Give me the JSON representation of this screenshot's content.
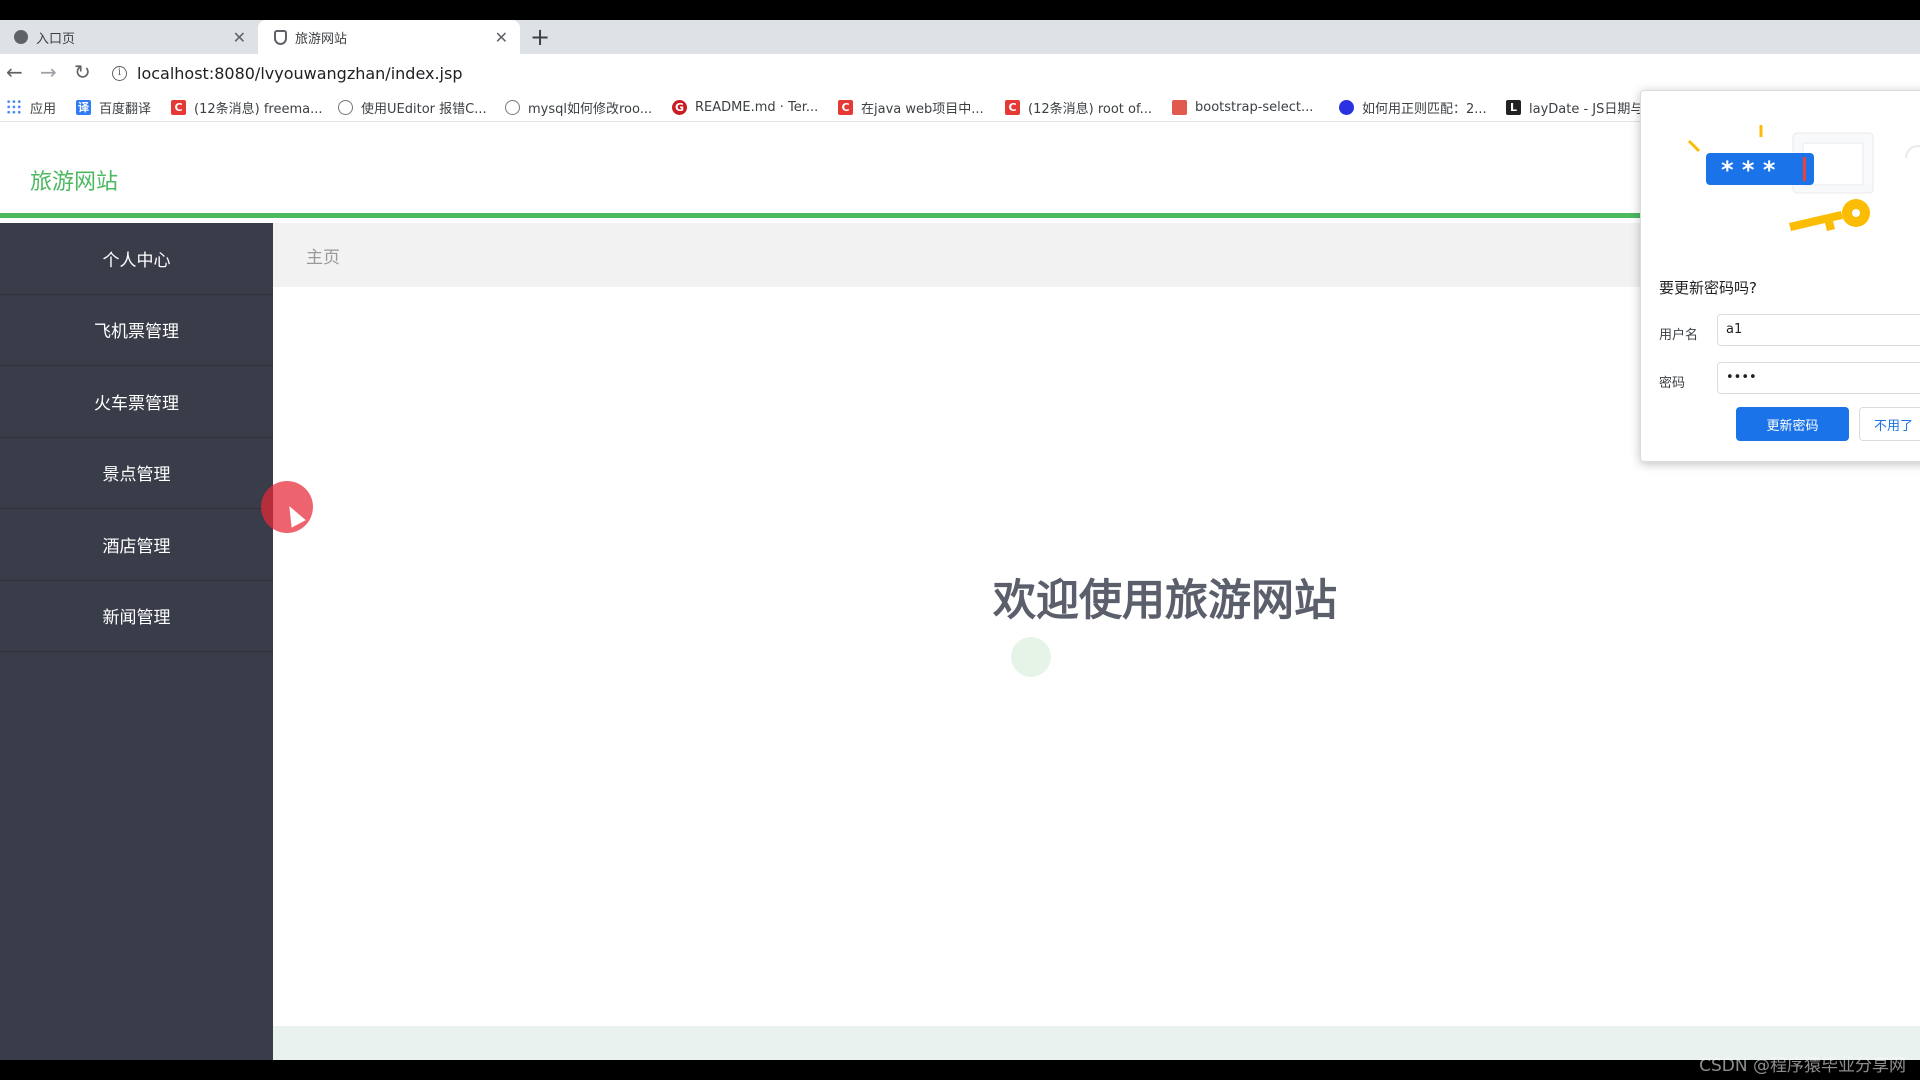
{
  "browser": {
    "tabs": [
      {
        "title": "入口页",
        "icon": "globe-icon"
      },
      {
        "title": "旅游网站",
        "icon": "shield-icon"
      }
    ],
    "new_tab": "+",
    "nav": {
      "back": "←",
      "forward": "→",
      "reload": "↻"
    },
    "url": "localhost:8080/lvyouwangzhan/index.jsp",
    "bookmarks": [
      {
        "label": "应用",
        "icon": "apps-icon",
        "color": "#4285f4"
      },
      {
        "label": "百度翻译",
        "icon": "translate-icon",
        "color": "#2f7cf6"
      },
      {
        "label": "(12条消息) freema...",
        "icon": "csdn-icon",
        "color": "#e53935"
      },
      {
        "label": "使用UEditor 报错C...",
        "icon": "bookmark-icon",
        "color": "#333333"
      },
      {
        "label": "mysql如何修改roo...",
        "icon": "bookmark-icon",
        "color": "#333333"
      },
      {
        "label": "README.md · Ter...",
        "icon": "gitee-icon",
        "color": "#c71d23"
      },
      {
        "label": "在java web项目中...",
        "icon": "csdn-icon",
        "color": "#e53935"
      },
      {
        "label": "(12条消息) root of...",
        "icon": "csdn-icon",
        "color": "#e53935"
      },
      {
        "label": "bootstrap-select...",
        "icon": "bookmark-icon",
        "color": "#e05a4f"
      },
      {
        "label": "如何用正则匹配：2...",
        "icon": "baidu-icon",
        "color": "#2932e1"
      },
      {
        "label": "layDate - JS日期与",
        "icon": "layui-icon",
        "color": "#222222"
      }
    ]
  },
  "page": {
    "logo": "旅游网站",
    "menu": [
      "个人中心",
      "飞机票管理",
      "火车票管理",
      "景点管理",
      "酒店管理",
      "新闻管理"
    ],
    "breadcrumb": "主页",
    "welcome": "欢迎使用旅游网站",
    "accent_color": "#4cb860",
    "sidebar_color": "#393d49"
  },
  "password_popup": {
    "title": "要更新密码吗?",
    "username_label": "用户名",
    "username_value": "a1",
    "password_label": "密码",
    "password_value": "••••",
    "update_label": "更新密码",
    "decline_label": "不用了",
    "illustration_text": "* * *"
  },
  "watermark": "CSDN @程序猿毕业分享网"
}
